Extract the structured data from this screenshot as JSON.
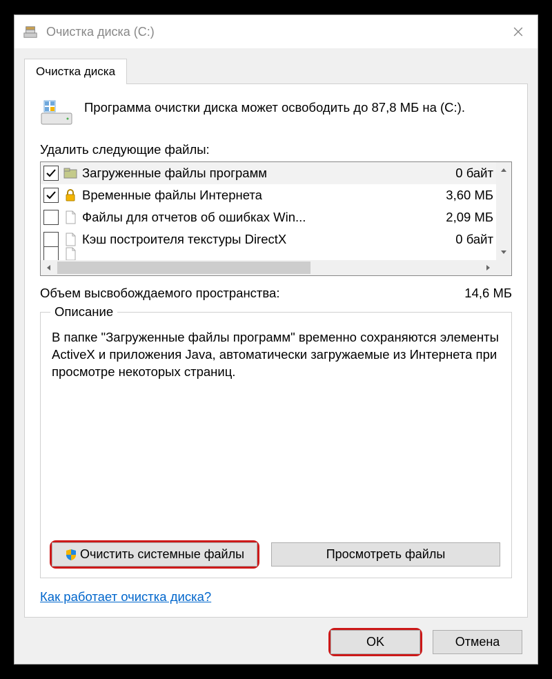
{
  "window": {
    "title": "Очистка диска  (C:)"
  },
  "tab": {
    "label": "Очистка диска"
  },
  "summary": {
    "text": "Программа очистки диска может освободить до 87,8 МБ на  (C:)."
  },
  "list": {
    "label": "Удалить следующие файлы:",
    "items": [
      {
        "checked": true,
        "icon": "folder",
        "name": "Загруженные файлы программ",
        "size": "0 байт",
        "selected": true
      },
      {
        "checked": true,
        "icon": "lock",
        "name": "Временные файлы Интернета",
        "size": "3,60 МБ",
        "selected": false
      },
      {
        "checked": false,
        "icon": "file",
        "name": "Файлы для отчетов об ошибках Win...",
        "size": "2,09 МБ",
        "selected": false
      },
      {
        "checked": false,
        "icon": "file",
        "name": "Кэш построителя текстуры DirectX",
        "size": "0 байт",
        "selected": false
      }
    ]
  },
  "totals": {
    "label": "Объем высвобождаемого пространства:",
    "value": "14,6 МБ"
  },
  "description": {
    "legend": "Описание",
    "text": "В папке \"Загруженные файлы программ\" временно сохраняются элементы ActiveX и приложения Java, автоматически загружаемые из Интернета при просмотре некоторых страниц."
  },
  "buttons": {
    "clean_system": "Очистить системные файлы",
    "view_files": "Просмотреть файлы",
    "ok": "OK",
    "cancel": "Отмена"
  },
  "link": {
    "text": "Как работает очистка диска?"
  }
}
